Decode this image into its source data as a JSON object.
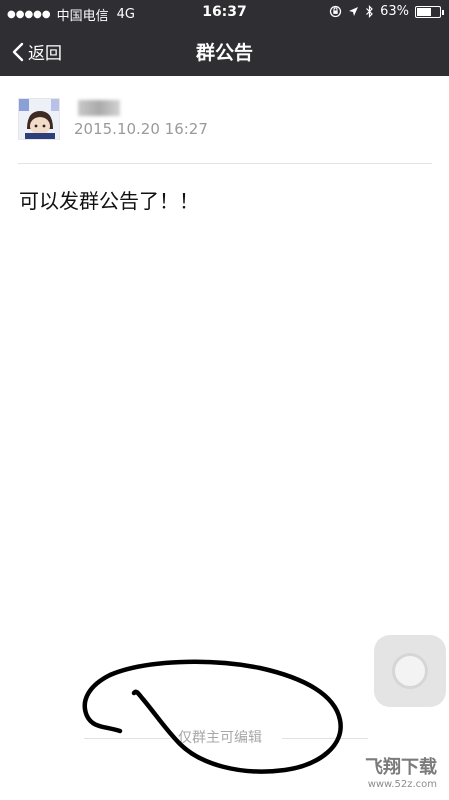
{
  "status_bar": {
    "carrier": "中国电信",
    "network": "4G",
    "time": "16:37",
    "battery": "63%",
    "battery_level": 0.63,
    "icons": [
      "signal-dots-icon",
      "rotation-lock-icon",
      "location-arrow-icon",
      "bluetooth-icon",
      "battery-icon"
    ]
  },
  "nav": {
    "back_label": "返回",
    "title": "群公告"
  },
  "post": {
    "datetime": "2015.10.20  16:27",
    "content": "可以发群公告了！！"
  },
  "footer": {
    "note": "仅群主可编辑"
  },
  "watermark": {
    "main": "飞翔下载",
    "url": "www.52z.com"
  },
  "colors": {
    "nav_bg": "#2e2e33",
    "meta_text": "#9a9a9a",
    "annotation_ink": "#000000"
  }
}
